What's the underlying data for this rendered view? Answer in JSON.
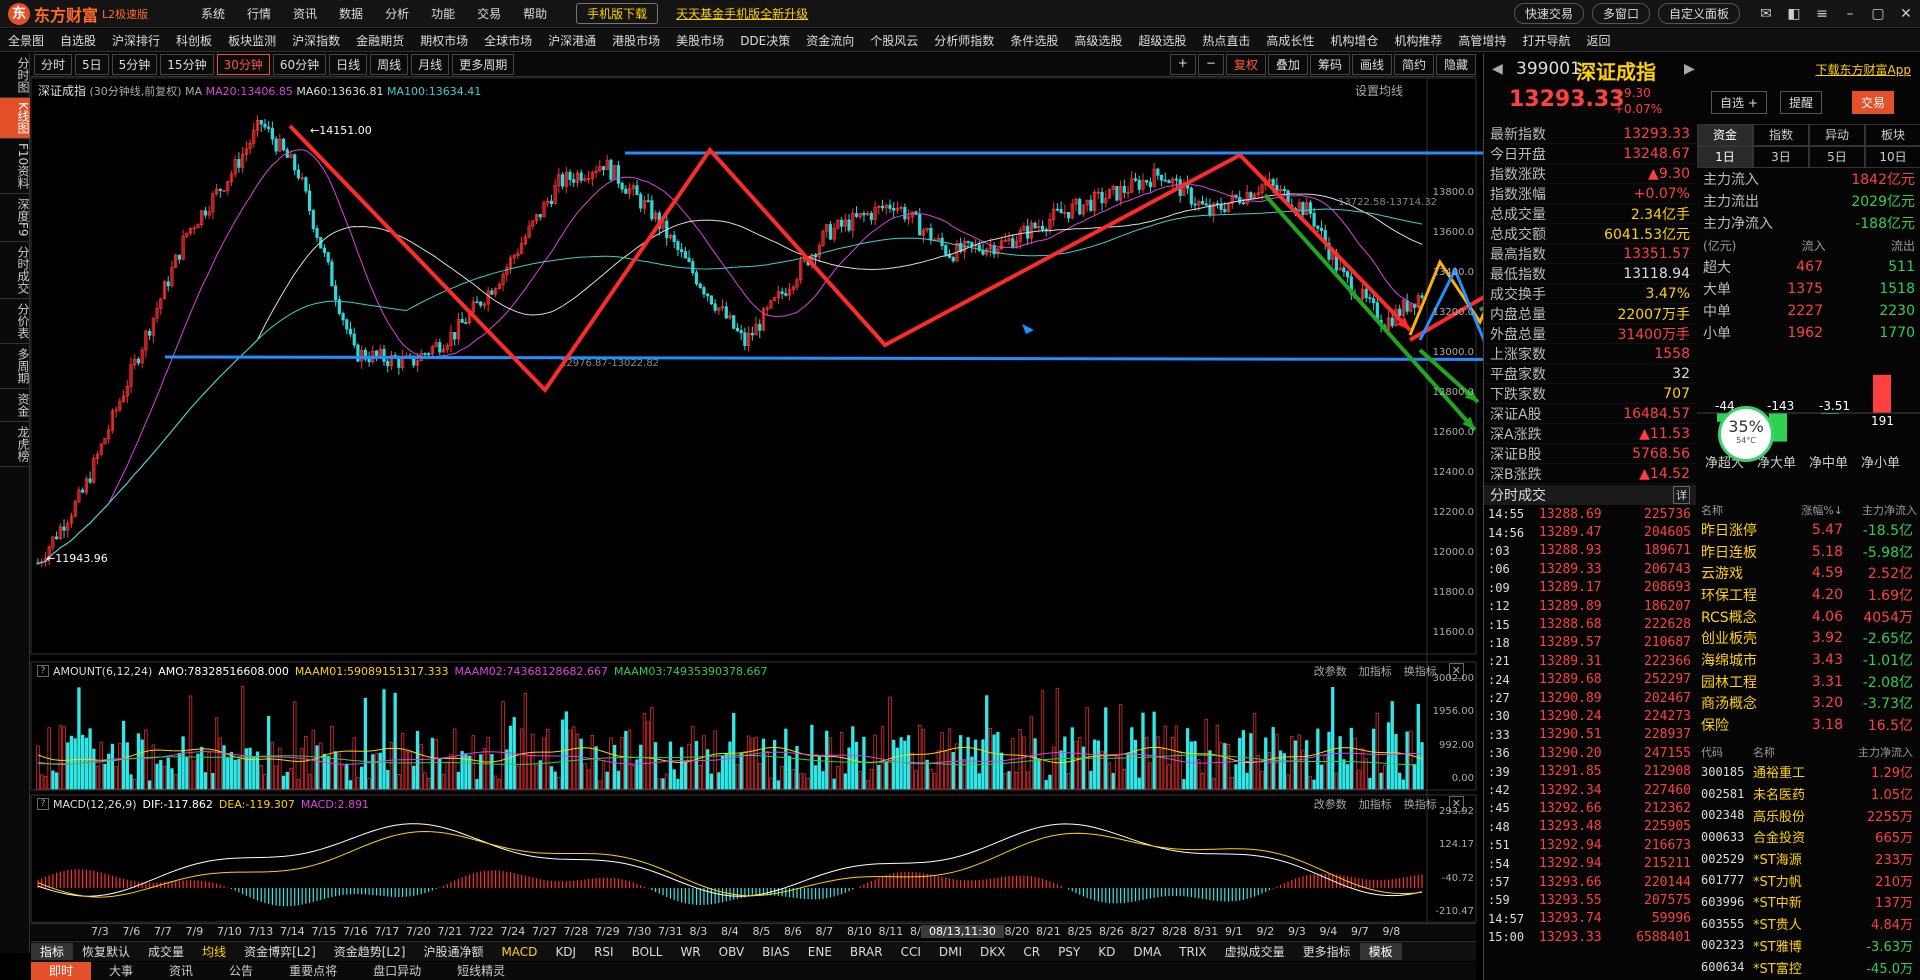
{
  "app": {
    "logo_text": "东方财富",
    "version": "L2极速版",
    "menu": [
      "系统",
      "行情",
      "资讯",
      "数据",
      "分析",
      "功能",
      "交易",
      "帮助"
    ],
    "promo_mobile": "手机版下载",
    "promo_fund": "天天基金手机版全新升级",
    "right_buttons": [
      "快速交易",
      "多窗口",
      "自定义面板"
    ]
  },
  "menubar": [
    "全景图",
    "自选股",
    "沪深排行",
    "科创板",
    "板块监测",
    "沪深指数",
    "金融期货",
    "期权市场",
    "全球市场",
    "沪深港通",
    "港股市场",
    "美股市场",
    "DDE决策",
    "资金流向",
    "个股风云",
    "分析师指数",
    "条件选股",
    "高级选股",
    "超级选股",
    "热点直击",
    "高成长性",
    "机构增仓",
    "机构推荐",
    "高管增持",
    "打开导航",
    "返回"
  ],
  "left_tabs": [
    "分时图",
    "K线图",
    "F10资料",
    "深度F9",
    "分时成交",
    "分价表",
    "多周期",
    "资金",
    "龙虎榜"
  ],
  "periods": [
    "分时",
    "5日",
    "5分钟",
    "15分钟",
    "30分钟",
    "60分钟",
    "日线",
    "周线",
    "月线",
    "更多周期"
  ],
  "active_period": "30分钟",
  "chart_tools": [
    "+",
    "−",
    "复权",
    "叠加",
    "筹码",
    "画线",
    "简约",
    "隐藏"
  ],
  "chart_header": {
    "name": "深证成指",
    "params": "(30分钟线,前复权) MA",
    "ma20": "MA20:13406.85",
    "ma60": "MA60:13636.81",
    "ma100": "MA100:13634.41",
    "set_ma": "设置均线"
  },
  "price_axis": [
    "13800.0",
    "13600.0",
    "13400.0",
    "13200.0",
    "13000.0",
    "12800.0",
    "12600.0",
    "12400.0",
    "12200.0",
    "12000.0",
    "11800.0",
    "11600.0"
  ],
  "annotations": {
    "high": "14151.00",
    "low": "11943.96",
    "zone_low": "12976.87-13022.82",
    "zone_high": "13722.58-13714.32"
  },
  "volume_header": {
    "name": "AMOUNT(6,12,24)",
    "amo": "AMO:78328516608.000",
    "m1": "MAAM01:59089151317.333",
    "m2": "MAAM02:74368128682.667",
    "m3": "MAAM03:74935390378.667",
    "actions": [
      "改参数",
      "加指标",
      "换指标"
    ]
  },
  "volume_axis": [
    "3002.00",
    "1956.00",
    "992.00",
    "0.00"
  ],
  "macd_header": {
    "name": "MACD(12,26,9)",
    "dif": "DIF:-117.862",
    "dea": "DEA:-119.307",
    "macd": "MACD:2.891",
    "actions": [
      "改参数",
      "加指标",
      "换指标"
    ]
  },
  "macd_axis": [
    "293.92",
    "124.17",
    "-40.72",
    "-210.47"
  ],
  "dates": [
    "7/3",
    "7/6",
    "7/7",
    "7/9",
    "7/10",
    "7/13",
    "7/14",
    "7/15",
    "7/16",
    "7/17",
    "7/20",
    "7/21",
    "7/22",
    "7/24",
    "7/27",
    "7/28",
    "7/29",
    "7/30",
    "7/31",
    "8/3",
    "8/4",
    "8/5",
    "8/6",
    "8/7",
    "8/10",
    "8/11",
    "8/12",
    "8/18",
    "8/19",
    "8/20",
    "8/21",
    "8/25",
    "8/26",
    "8/27",
    "8/28",
    "8/31",
    "9/1",
    "9/2",
    "9/3",
    "9/4",
    "9/7",
    "9/8"
  ],
  "cursor_date": "08/13,11:30",
  "indicators": [
    "指标",
    "恢复默认",
    "成交量",
    "均线",
    "资金博弈[L2]",
    "资金趋势[L2]",
    "沪股通净额",
    "MACD",
    "KDJ",
    "RSI",
    "BOLL",
    "WR",
    "OBV",
    "BIAS",
    "ENE",
    "BRAR",
    "CCI",
    "DMI",
    "DKX",
    "CR",
    "PSY",
    "KD",
    "DMA",
    "TRIX",
    "虚拟成交量",
    "更多指标",
    "模板"
  ],
  "bottom_tabs": [
    "即时",
    "大事",
    "资讯",
    "公告",
    "重要点将",
    "盘口异动",
    "短线精灵"
  ],
  "quote": {
    "code": "399001",
    "name": "深证成指",
    "download": "下载东方财富App",
    "price": "13293.33",
    "change": "+9.30",
    "change_pct": "+0.07%",
    "buttons": [
      "自选 +",
      "提醒",
      "交易"
    ],
    "rows": [
      {
        "k": "最新指数",
        "v": "13293.33",
        "c": "r"
      },
      {
        "k": "今日开盘",
        "v": "13248.67",
        "c": "r"
      },
      {
        "k": "指数涨跌",
        "v": "▲9.30",
        "c": "r"
      },
      {
        "k": "指数涨幅",
        "v": "+0.07%",
        "c": "r"
      },
      {
        "k": "总成交量",
        "v": "2.34亿手",
        "c": "y"
      },
      {
        "k": "总成交额",
        "v": "6041.53亿元",
        "c": "y"
      },
      {
        "k": "最高指数",
        "v": "13351.57",
        "c": "r"
      },
      {
        "k": "最低指数",
        "v": "13118.94",
        "c": "w"
      },
      {
        "k": "成交换手",
        "v": "3.47%",
        "c": "y"
      },
      {
        "k": "内盘总量",
        "v": "22007万手",
        "c": "y"
      },
      {
        "k": "外盘总量",
        "v": "31400万手",
        "c": "r"
      },
      {
        "k": "上涨家数",
        "v": "1558",
        "c": "r"
      },
      {
        "k": "平盘家数",
        "v": "32",
        "c": "w"
      },
      {
        "k": "下跌家数",
        "v": "707",
        "c": "y"
      },
      {
        "k": "深证A股",
        "v": "16484.57",
        "c": "r"
      },
      {
        "k": "深A涨跌",
        "v": "▲11.53",
        "c": "r"
      },
      {
        "k": "深证B股",
        "v": "5768.56",
        "c": "r"
      },
      {
        "k": "深B涨跌",
        "v": "▲14.52",
        "c": "r"
      }
    ]
  },
  "fund": {
    "tabs": [
      "资金",
      "指数",
      "异动",
      "板块"
    ],
    "subtabs": [
      "1日",
      "3日",
      "5日",
      "10日"
    ],
    "rows": [
      {
        "k": "主力流入",
        "v": "1842亿元",
        "g": false
      },
      {
        "k": "主力流出",
        "v": "2029亿元",
        "g": true
      },
      {
        "k": "主力净流入",
        "v": "-188亿元",
        "g": true
      }
    ],
    "table_head": [
      "(亿元)",
      "流入",
      "流出"
    ],
    "table": [
      {
        "k": "超大",
        "i": "467",
        "o": "511"
      },
      {
        "k": "大单",
        "i": "1375",
        "o": "1518"
      },
      {
        "k": "中单",
        "i": "2227",
        "o": "2230"
      },
      {
        "k": "小单",
        "i": "1962",
        "o": "1770"
      }
    ],
    "net_labels": [
      "净超大",
      "净大单",
      "净中单",
      "净小单"
    ],
    "net_values": [
      -44,
      -143,
      -3.51,
      191
    ],
    "net_text": [
      "-44",
      "-143",
      "-3.51",
      "191"
    ]
  },
  "gauge": {
    "pct": "35%",
    "temp": "54°C"
  },
  "ticks_header": "分时成交",
  "ticks_detail": "详",
  "ticks": [
    {
      "t": "14:55",
      "p": "13288.69",
      "v": "225736"
    },
    {
      "t": "14:56",
      "p": "13289.47",
      "v": "204605"
    },
    {
      "t": ":03",
      "p": "13288.93",
      "v": "189671"
    },
    {
      "t": ":06",
      "p": "13289.33",
      "v": "206743"
    },
    {
      "t": ":09",
      "p": "13289.17",
      "v": "208693"
    },
    {
      "t": ":12",
      "p": "13289.89",
      "v": "186207"
    },
    {
      "t": ":15",
      "p": "13288.68",
      "v": "222628"
    },
    {
      "t": ":18",
      "p": "13289.57",
      "v": "210687"
    },
    {
      "t": ":21",
      "p": "13289.31",
      "v": "222366"
    },
    {
      "t": ":24",
      "p": "13289.68",
      "v": "252297"
    },
    {
      "t": ":27",
      "p": "13290.89",
      "v": "202467"
    },
    {
      "t": ":30",
      "p": "13290.24",
      "v": "224273"
    },
    {
      "t": ":33",
      "p": "13290.51",
      "v": "228937"
    },
    {
      "t": ":36",
      "p": "13290.20",
      "v": "247155"
    },
    {
      "t": ":39",
      "p": "13291.85",
      "v": "212908"
    },
    {
      "t": ":42",
      "p": "13292.34",
      "v": "227460"
    },
    {
      "t": ":45",
      "p": "13292.66",
      "v": "212362"
    },
    {
      "t": ":48",
      "p": "13293.48",
      "v": "225905"
    },
    {
      "t": ":51",
      "p": "13292.94",
      "v": "216673"
    },
    {
      "t": ":54",
      "p": "13292.94",
      "v": "215211"
    },
    {
      "t": ":57",
      "p": "13293.66",
      "v": "220144"
    },
    {
      "t": ":59",
      "p": "13293.55",
      "v": "207575"
    },
    {
      "t": "14:57",
      "p": "13293.74",
      "v": "59996"
    },
    {
      "t": "15:00",
      "p": "13293.33",
      "v": "6588401"
    }
  ],
  "sectors_head": [
    "名称",
    "涨幅%↓",
    "主力净流入"
  ],
  "sectors": [
    {
      "n": "昨日涨停",
      "c": "5.47",
      "f": "-18.5亿",
      "g": true
    },
    {
      "n": "昨日连板",
      "c": "5.18",
      "f": "-5.98亿",
      "g": true
    },
    {
      "n": "云游戏",
      "c": "4.59",
      "f": "2.52亿",
      "g": false
    },
    {
      "n": "环保工程",
      "c": "4.20",
      "f": "1.69亿",
      "g": false
    },
    {
      "n": "RCS概念",
      "c": "4.06",
      "f": "4054万",
      "g": false
    },
    {
      "n": "创业板壳",
      "c": "3.92",
      "f": "-2.65亿",
      "g": true
    },
    {
      "n": "海绵城市",
      "c": "3.43",
      "f": "-1.01亿",
      "g": true
    },
    {
      "n": "园林工程",
      "c": "3.31",
      "f": "-2.08亿",
      "g": true
    },
    {
      "n": "商汤概念",
      "c": "3.20",
      "f": "-3.73亿",
      "g": true
    },
    {
      "n": "保险",
      "c": "3.18",
      "f": "16.5亿",
      "g": false
    }
  ],
  "stocks_head": [
    "代码",
    "名称",
    "主力净流入"
  ],
  "stocks": [
    {
      "cd": "300185",
      "nm": "通裕重工",
      "fv": "1.29亿",
      "g": false
    },
    {
      "cd": "002581",
      "nm": "未名医药",
      "fv": "1.05亿",
      "g": false
    },
    {
      "cd": "002348",
      "nm": "高乐股份",
      "fv": "2255万",
      "g": false
    },
    {
      "cd": "000633",
      "nm": "合金投资",
      "fv": "665万",
      "g": false
    },
    {
      "cd": "002529",
      "nm": "*ST海源",
      "fv": "233万",
      "g": false
    },
    {
      "cd": "601777",
      "nm": "*ST力帆",
      "fv": "210万",
      "g": false
    },
    {
      "cd": "603996",
      "nm": "*ST中新",
      "fv": "137万",
      "g": false
    },
    {
      "cd": "603555",
      "nm": "*ST贵人",
      "fv": "4.84万",
      "g": false
    },
    {
      "cd": "002323",
      "nm": "*ST雅博",
      "fv": "-3.63万",
      "g": true
    },
    {
      "cd": "600634",
      "nm": "*ST富控",
      "fv": "-45.0万",
      "g": true
    }
  ],
  "colors": {
    "up": "#ff4040",
    "down": "#30d0d0",
    "accent": "#e4502a",
    "gold": "#ffd200",
    "blue_line": "#1e90ff",
    "green_arrow": "#1fa81f",
    "orange_arrow": "#ffb000"
  }
}
